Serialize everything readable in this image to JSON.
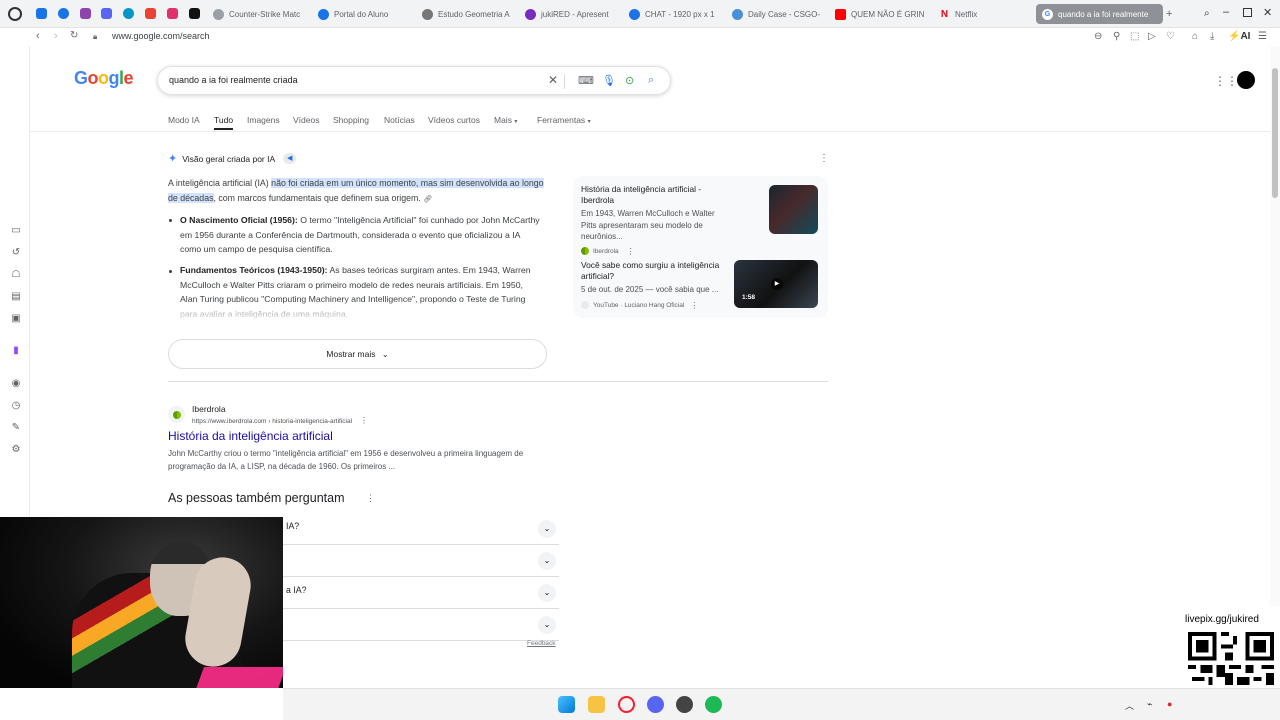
{
  "browser": {
    "tabs": [
      {
        "label": "Counter-Strike Matc",
        "color": "#9aa0a6"
      },
      {
        "label": "Portal do Aluno",
        "color": "#1a73e8"
      },
      {
        "label": "Estudo Geometria A",
        "color": "#777"
      },
      {
        "label": "jukiRED - Apresent",
        "color": "#7b2cbf"
      },
      {
        "label": "CHAT - 1920 px x 1",
        "color": "#1a73e8"
      },
      {
        "label": "Daily Case - CSGO-",
        "color": "#4a90d9"
      },
      {
        "label": "QUEM NÃO É GRIN",
        "color": "#ff0000"
      },
      {
        "label": "Netflix",
        "color": "#e50914"
      },
      {
        "label": "quando a ia foi realmente",
        "color": "#ffffff"
      }
    ],
    "url": "www.google.com/search",
    "ai_label": "AI"
  },
  "google": {
    "logo": "Google",
    "query": "quando a ia foi realmente criada",
    "tabs": [
      "Modo IA",
      "Tudo",
      "Imagens",
      "Vídeos",
      "Shopping",
      "Notícias",
      "Vídeos curtos",
      "Mais",
      "Ferramentas"
    ]
  },
  "ai_overview": {
    "heading": "Visão geral criada por IA",
    "intro_pre": "A inteligência artificial (IA) ",
    "intro_highlight": "não foi criada em um único momento, mas sim desenvolvida ao longo de décadas",
    "intro_post": ", com marcos fundamentais que definem sua origem.",
    "bullet1_title": "O Nascimento Oficial (1956):",
    "bullet1_text": " O termo \"Inteligência Artificial\" foi cunhado por John McCarthy em 1956 durante a Conferência de Dartmouth, considerada o evento que oficializou a IA como um campo de pesquisa científica.",
    "bullet2_title": "Fundamentos Teóricos (1943-1950):",
    "bullet2_text": " As bases teóricas surgiram antes. Em 1943, Warren McCulloch e Walter Pitts criaram o primeiro modelo de redes neurais artificiais. Em 1950, Alan Turing publicou \"Computing Machinery and Intelligence\", propondo o Teste de Turing para avaliar a inteligência de uma máquina.",
    "show_more": "Mostrar mais",
    "sources": [
      {
        "title": "História da inteligência artificial - Iberdrola",
        "snippet": "Em 1943, Warren McCulloch e Walter Pitts apresentaram seu modelo de neurônios...",
        "site": "Iberdrola"
      },
      {
        "title": "Você sabe como surgiu a inteligência artificial?",
        "snippet": "5 de out. de 2025 — você sabia que ...",
        "site": "YouTube · Luciano Hang Oficial",
        "duration": "1:58"
      }
    ]
  },
  "result": {
    "site": "Iberdrola",
    "url": "https://www.iberdrola.com › historia-inteligencia-artificial",
    "title": "História da inteligência artificial",
    "snippet": "John McCarthy criou o termo \"inteligência artificial\" em 1956 e desenvolveu a primeira linguagem de programação da IA, a LISP, na década de 1960. Os primeiros ..."
  },
  "paa": {
    "title": "As pessoas também perguntam",
    "questions": [
      "IA?",
      "",
      "a IA?",
      ""
    ],
    "feedback": "Feedback"
  },
  "overlay": {
    "qr_label": "livepix.gg/jukired"
  }
}
